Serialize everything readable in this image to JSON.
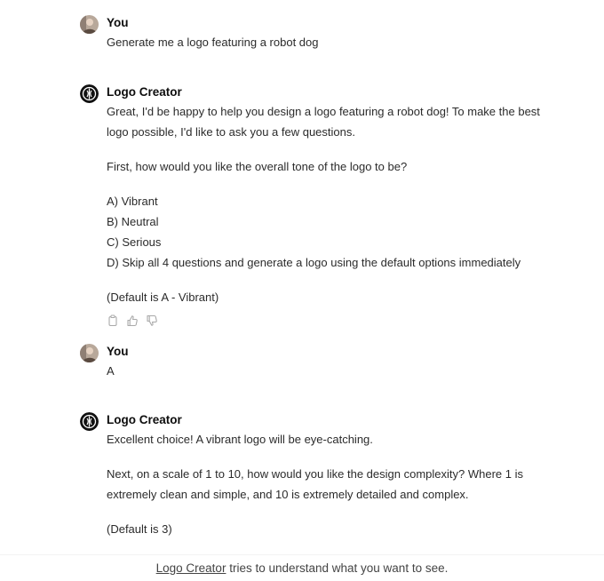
{
  "messages": [
    {
      "author": "You",
      "avatar_icon": "user-photo-icon",
      "lines": [
        "Generate me a logo featuring a robot dog"
      ]
    },
    {
      "author": "Logo Creator",
      "avatar_icon": "logo-creator-icon",
      "paragraph1": [
        "Great, I'd be happy to help you design a logo featuring a robot dog! To make the best",
        "logo possible, I'd like to ask you a few questions."
      ],
      "question": "First, how would you like the overall tone of the logo to be?",
      "options": [
        "A) Vibrant",
        "B) Neutral",
        "C) Serious",
        "D) Skip all 4 questions and generate a logo using the default options immediately"
      ],
      "default_note": "(Default is A - Vibrant)",
      "actions": [
        "copy-icon",
        "thumbs-up-icon",
        "thumbs-down-icon"
      ]
    },
    {
      "author": "You",
      "avatar_icon": "user-photo-icon",
      "lines": [
        "A"
      ]
    },
    {
      "author": "Logo Creator",
      "avatar_icon": "logo-creator-icon",
      "paragraph1": [
        "Excellent choice! A vibrant logo will be eye-catching."
      ],
      "paragraph2": [
        "Next, on a scale of 1 to 10, how would you like the design complexity? Where 1 is",
        "extremely clean and simple, and 10 is extremely detailed and complex."
      ],
      "default_note": "(Default is 3)"
    }
  ],
  "footer": {
    "link_text": "Logo Creator",
    "suffix": " tries to understand what you want to see."
  }
}
